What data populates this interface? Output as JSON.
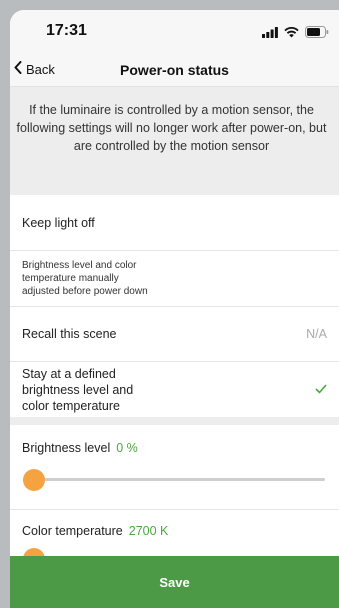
{
  "status_bar": {
    "time": "17:31",
    "icons": [
      "signal-icon",
      "wifi-icon",
      "battery-icon"
    ]
  },
  "nav": {
    "back_label": "Back",
    "title": "Power-on status"
  },
  "info": {
    "lines": [
      "If the luminaire is controlled by a motion sensor, the",
      "following settings will no longer work after power-on, but",
      "are controlled by the motion sensor"
    ]
  },
  "options": [
    {
      "label": "Keep light off"
    },
    {
      "label_lines": [
        "Brightness level and color",
        "temperature manually",
        "adjusted before power down"
      ]
    },
    {
      "label": "Recall this scene",
      "value": "N/A"
    },
    {
      "label_lines": [
        "Stay at a defined",
        "brightness level and",
        "color temperature"
      ],
      "selected": true
    }
  ],
  "brightness": {
    "label": "Brightness level",
    "value": "0 %",
    "level": 0
  },
  "color_temperature": {
    "label": "Color temperature",
    "value": "2700 K",
    "level": 0
  },
  "save_label": "Save",
  "colors": {
    "accent_green": "#4c9a45",
    "value_green": "#4aa83e",
    "knob_orange": "#f4a340"
  }
}
